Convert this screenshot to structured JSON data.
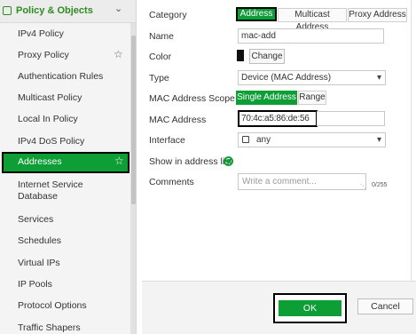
{
  "sidebar": {
    "section_title": "Policy & Objects",
    "items": [
      {
        "label": "IPv4 Policy"
      },
      {
        "label": "Proxy Policy"
      },
      {
        "label": "Authentication Rules"
      },
      {
        "label": "Multicast Policy"
      },
      {
        "label": "Local In Policy"
      },
      {
        "label": "IPv4 DoS Policy"
      },
      {
        "label": "Addresses"
      },
      {
        "label": "Internet Service Database"
      },
      {
        "label": "Services"
      },
      {
        "label": "Schedules"
      },
      {
        "label": "Virtual IPs"
      },
      {
        "label": "IP Pools"
      },
      {
        "label": "Protocol Options"
      },
      {
        "label": "Traffic Shapers"
      }
    ]
  },
  "form": {
    "category": {
      "label": "Category",
      "options": [
        "Address",
        "Multicast Address",
        "Proxy Address"
      ],
      "selected": "Address"
    },
    "name": {
      "label": "Name",
      "value": "mac-add"
    },
    "color": {
      "label": "Color",
      "button": "Change",
      "swatch": "#111111"
    },
    "type": {
      "label": "Type",
      "value": "Device (MAC Address)"
    },
    "mac_scope": {
      "label": "MAC Address Scope",
      "options": [
        "Single Address",
        "Range"
      ],
      "selected": "Single Address"
    },
    "mac_address": {
      "label": "MAC Address",
      "value": "70:4c:a5:86:de:56"
    },
    "interface": {
      "label": "Interface",
      "value": "any"
    },
    "show_in_list": {
      "label": "Show in address list",
      "enabled": true
    },
    "comments": {
      "label": "Comments",
      "placeholder": "Write a comment...",
      "counter": "0/255"
    }
  },
  "footer": {
    "ok_label": "OK",
    "cancel_label": "Cancel"
  },
  "colors": {
    "accent": "#0e9e36",
    "highlight_outline": "#000000"
  }
}
